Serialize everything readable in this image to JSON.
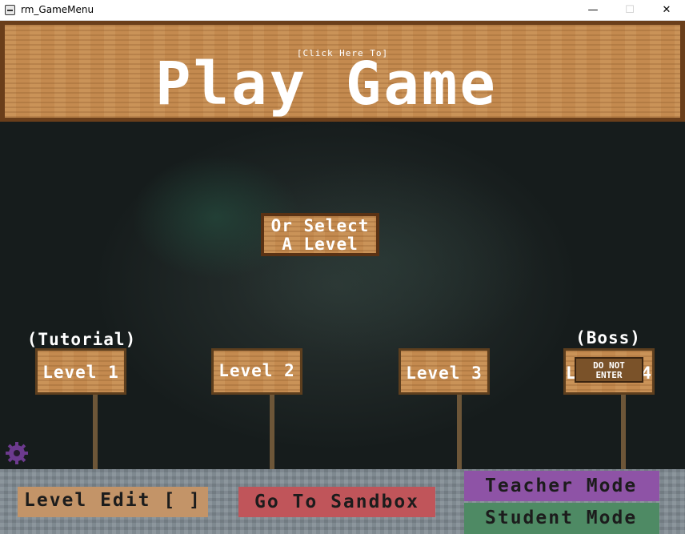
{
  "window": {
    "title": "rm_GameMenu",
    "minimize_glyph": "—",
    "maximize_glyph": "☐",
    "close_glyph": "✕"
  },
  "banner": {
    "hint": "[Click Here To]",
    "title": "Play Game"
  },
  "select_sign": {
    "line1": "Or Select",
    "line2": "A Level"
  },
  "levels": [
    {
      "label": "Level 1",
      "note": "(Tutorial)"
    },
    {
      "label": "Level 2",
      "note": ""
    },
    {
      "label": "Level 3",
      "note": ""
    },
    {
      "label": "Level 4",
      "note": "(Boss)",
      "visible_left": "L",
      "visible_right": "4",
      "blocker_line1": "DO NOT",
      "blocker_line2": "ENTER"
    }
  ],
  "bottom_bar": {
    "level_edit": "Level Edit [ ]",
    "sandbox": "Go To Sandbox",
    "teacher": "Teacher Mode",
    "student": "Student Mode"
  },
  "icons": {
    "app": "app-window-icon",
    "settings": "gear-icon"
  },
  "colors": {
    "wood": "#c48a4f",
    "wood_border": "#6a3e1a",
    "level_edit_bg": "#c39468",
    "sandbox_bg": "#c0555a",
    "teacher_bg": "#8e53a6",
    "student_bg": "#4e8a64",
    "gear": "#6c3a8e"
  }
}
